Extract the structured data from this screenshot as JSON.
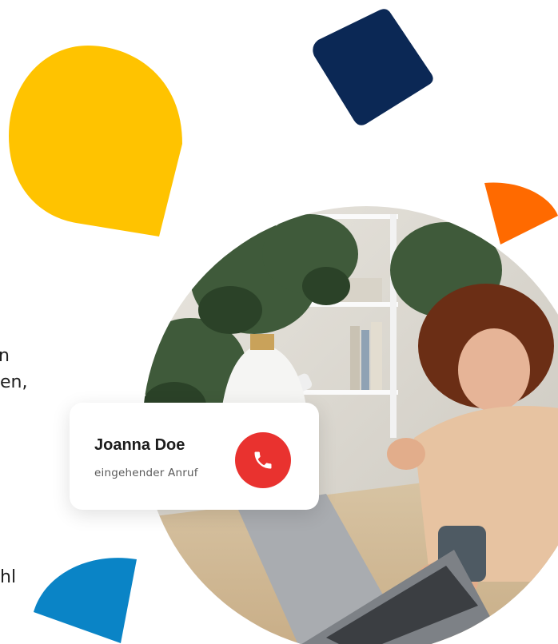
{
  "card": {
    "caller_name": "Joanna Doe",
    "call_status": "eingehender Anruf"
  },
  "clipped_text": {
    "line1": "n",
    "line2": "en,",
    "line3": "hl"
  },
  "icons": {
    "call": "phone-icon"
  },
  "colors": {
    "yellow": "#ffc300",
    "navy": "#0b2855",
    "orange": "#ff6a00",
    "blue": "#0a84c6",
    "call_red": "#e9322f"
  }
}
